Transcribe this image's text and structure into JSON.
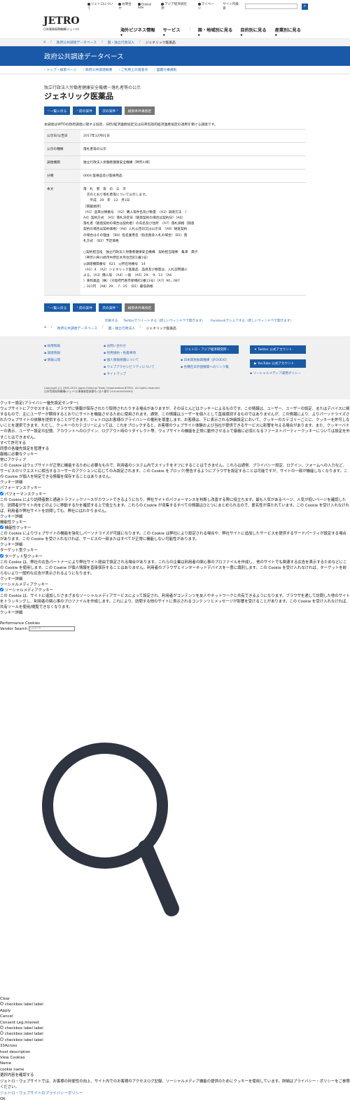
{
  "util": {
    "about": "ジェトロについて",
    "contact": "お問合せ",
    "global": "Global Site",
    "ide": "アジア経済研究所",
    "mypage": "マイページ",
    "search_ph": "サイト内検索"
  },
  "logo": {
    "name": "JETRO",
    "sub": "日本貿易振興機構(ジェトロ)"
  },
  "gnav": [
    "海外ビジネス情報",
    "サービス",
    "国・地域別に見る",
    "目的別に見る",
    "産業別に見る"
  ],
  "crumb1": [
    "政府公共調達データベース",
    "国・独立行政法人",
    "ジェネリック医薬品"
  ],
  "banner": "政府公共調達データベース",
  "subnav": [
    "トップ・検索ページ",
    "政府公共調達概要",
    "ご利用上の留意点",
    "図鑑付番規則"
  ],
  "pre": "独立行政法人労働者健康安全機構－落札者等の公示",
  "title": "ジェネリック医薬品",
  "buttons": [
    "一覧に戻る",
    "前の案件",
    "次の案件",
    "検索条件再指定"
  ],
  "lead": "本調達はWTOの政府調達に関する協定、日EU経済連携協定又は日英包括的経済連携協定の適用を受ける調達です。",
  "table": [
    {
      "k": "公示日/公告日",
      "v": "2017年12月01日"
    },
    {
      "k": "公示の種類",
      "v": "落札者等の公示"
    },
    {
      "k": "調達機関",
      "v": "独立行政法人労働者健康安全機構（神奈川県）"
    },
    {
      "k": "分類",
      "v": "0004 医療品及び医療用品"
    }
  ],
  "body_k": "本文",
  "body_v": "落　札　者　等　の　公　示\n　次のとおり落札者等について公示します。\n　　平成　29　年　12　月1日\n［掲載順序］\n（A1）品目分類番号　（A2）購入等件名及び数量　（A3）調達方法　（\nA4）契約方式　（A5）落札決定日（随意契約の場合は契約日）（A6）\n落札者（随意契約の場合は契約者）の氏名及び住所　（A7）落札価格（随意\n契約の場合は契約価格）（A8）入札公告日又は公示日　（A9）随意契約\nの場合はその理由　（B0）指名業者名（指名競争入札の場合）（B1）落\n札方式　（B2）予定価格\n\n○契約担当役　独立行政法人労働者健康安全機構　契約担当理事　亀澤　典子\n（神奈川県川崎市中原区木月住吉町1番1号）\n◎調達機関番号　621　◎所在地番号　14\n（A1）4　（A2）ジェネリック医薬品　品目及び数量は、入札説明書に\nよる。（A3）購入等　（A4）一般　（A5）29．　9．13　（A6\n）東和薬品（株）（大阪府門真市新橋町2番11号）（A7）90，087\n，321円　（A8）29．　7．25　（B1）最低価格",
  "share": [
    "印刷する",
    "Twitterでツイートする（新しいウィンドウで開きます）",
    "Facebookでシェアする（新しいウィンドウで開きます）"
  ],
  "crumb2": [
    "政府公共調達データベース",
    "国・独立行政法人",
    "ジェネリック医薬品"
  ],
  "footer": {
    "col1": [
      "採用情報",
      "調達情報",
      "情報公開"
    ],
    "col2": [
      "お問い合わせ",
      "利用規約・免責事項",
      "個人情報保護について",
      "ウェブアクセシビリティについて",
      "サイトマップ"
    ],
    "ide_btn": "ジェトロ・アジア経済研究所",
    "col3": [
      "日本貿易振興機構（JFOODO）",
      "各種在日外国機関へのリンク集"
    ],
    "tw": "Twitter 公式アカウント",
    "yt": "YouTube 公式アカウント",
    "social": "ソーシャルメディア運用ポリシー",
    "copy1": "Copyright (C) 1995-2022 Japan External Trade Organization(JETRO). All rights reserved.",
    "copy2": "日本貿易振興機構(ジェトロ)事業者登録番号 (法人番号 2010405003693)"
  },
  "cookie": {
    "h": "クッキー設定(プライバシー優先設定センター)",
    "intro": "ウェブサイトにアクセスすると、ブラウザに情報が保存されたり取得されたりする場合がありますが、そのほとんどはクッキーによるものです。この情報は、ユーザー、ユーザーの設定、またはデバイスに関するもので、主にユーザーが期待するとおりにサイトを機能させるために使用されます。通常、この情報はユーザーを個人として直接識別するものではありませんが、この情報により、よりパーソナライズされたウェブサイトの体験を提供することができます。ジェトロはお客様のプライバシーの権利を尊重します。お客様は、下に表示される詳細設定において、クッキーのカテゴリーごとに、クッキーを許可しないことを選択できます。ただし、クッキーのカテゴリーによっては、これをブロックすると、お客様のウェブサイト体験および当社が提供できるサービスに影響を与える場合があります。また、クッキーバナーの表示、ユーザー設定の記憶、アカウントへのログイン、ログアウト時のリダイレクト等、ウェブサイトの機能を正常に動作させる上で厳格に必須となるファーストパーティークッキーについては設定を外すことはできません。",
    "allow_all": "すべて許可する",
    "manage": "同意の各優先設定を管理する",
    "strict": "厳格に必要なクッキー",
    "always": "常にアクティブ",
    "strict_d": "この Cookie はウェブサイトが正常に機能するために必要なもので、利用者のシステム内でスイッチをオフにすることはできません。これらは通常、プライバシー設定、ログイン、フォームへの入力など、サービスのリクエストに相当するユーザーのアクションに応じてのみ設定されます。この Cookie をブロック/警告するようにブラウザを設定することは可能ですが、サイトの一部が機能しなくなります。この Cookie が個人を特定できる情報を保存することはありません。",
    "detail": "クッキー詳細",
    "perf": "パフォーマンスクッキー",
    "perf_d": "この Cookie により訪問者数と通過トラフィックソースがカウントできるようになり、弊社サイトのパフォーマンスを判断し改善する際に役立ちます。最も人気があるページ、人気が低いページを確認したり、訪問者がサイト内をどのように移動するかを確認する上で役立ちます。これらの Cookie が収集するすべての情報はひとつにまとめられるので、匿名性が保たれています。この Cookie を受け入れなければ、利用者が弊社サイトを訪問しても、弊社にはわかりません。",
    "func": "機能性クッキー",
    "func_d": "この Cookie によりウェブサイトの機能を強化しパーソナライズが可能になります。この Cookie は弊社により設定される場合や、弊社サイトに追加したサービスを提供するサードパーティが設定する場合があります。この Cookie を受け入れなければ、サービスの一部またはすべてが正常に機能しない可能性があります。",
    "target": "ターゲット型クッキー",
    "target_d": "この Cookie は、弊社の広告パートナーにより弊社サイト経由で設定される場合があります。これらの企業は利用者の関心事のプロファイルを作成し、他のサイトでも関連する広告を表示するためなどにこの Cookie を使用します。この Cookie が個人情報を直接保存することはありません。利用者のブラウザとインターネットデバイスを一意に識別します。この Cookie を受け入れなければ、ターゲットを絞らないより一般的な広告が表示されるようになります。",
    "social": "ソーシャルメディアクッキー",
    "social_d": "この Cookie は、サイトに追加したさまざまなソーシャルメディアサービスによって設定され、利用者がコンテンツを友人やネットワークと共有できるようになります。ブラウザを通して訪問した他のサイトをトラッキングし、利用者の関心事のプロファイルを作成します。これにより、訪問する他のサイトに表示されるコンテンツとメッセージが影響を受けることがあります。この Cookie を受け入れなければ、共有ツールを使用/閲覧できなくなります。",
    "perf_cookies": "Performance Cookies",
    "vendor": "Vendor Search",
    "vendor_ph": "Search..."
  },
  "lower": {
    "clear": "Clear",
    "cb": "checkbox label label",
    "apply": "Apply",
    "cancel": "Cancel",
    "consent": "Consent Leg.Interest",
    "across": "33Across",
    "host": "host description",
    "view": "View Cookies",
    "name": "Name",
    "cookie_name": "cookie name",
    "select": "選択内容を確認する",
    "notice": "ジェトロ・ウェブサイトでは、お客様の利便性の向上、サイト内でのお客様のアクセスログ記録、ソーシャルメディア機能の提供のためにクッキーを使用しています。詳細はプライバシー・ポリシーをご参照ください。",
    "policy": "ジェトロ・ウェブサイトのプライバシーポリシー",
    "ok": "OK"
  }
}
